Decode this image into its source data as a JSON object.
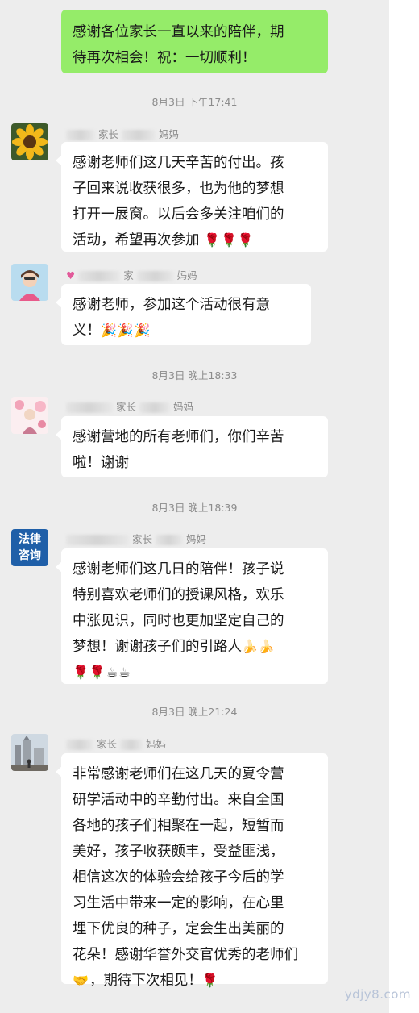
{
  "self_message": {
    "lines": [
      "感谢各位家长一直以来的陪伴，期",
      "待再次相会！祝：一切顺利！"
    ]
  },
  "messages": [
    {
      "time": "8月3日 下午17:41",
      "avatar": "sunflower-avatar",
      "sender_suffix_a": "家长",
      "sender_suffix_b": "妈妈",
      "lines": [
        "感谢老师们这几天辛苦的付出。孩",
        "子回来说收获很多，也为他的梦想",
        "打开一展窗。以后会多关注咱们的",
        "活动，希望再次参加"
      ],
      "emojis": "🌹🌹🌹"
    },
    {
      "time": "",
      "avatar": "girl-avatar",
      "sender_suffix_a": "家",
      "sender_suffix_b": "妈妈",
      "lines": [
        "感谢老师，参加这个活动很有意",
        "义！"
      ],
      "emojis": "🎉🎉🎉"
    },
    {
      "time": "8月3日 晚上18:33",
      "avatar": "flower-girl-avatar",
      "sender_suffix_a": "家长",
      "sender_suffix_b": "妈妈",
      "lines": [
        "感谢营地的所有老师们，你们辛苦",
        "啦！谢谢"
      ]
    },
    {
      "time": "8月3日 晚上18:39",
      "avatar": "legal-consult-avatar",
      "avatar_text": [
        "法律",
        "咨询"
      ],
      "sender_suffix_a": "家长",
      "sender_suffix_b": "妈妈",
      "lines": [
        "感谢老师们这几日的陪伴！孩子说",
        "特别喜欢老师们的授课风格，欢乐",
        "中涨见识，同时也更加坚定自己的",
        "梦想！谢谢孩子们的引路人"
      ],
      "emojis_line4": "🍌🍌",
      "emojis_line5": "🌹🌹☕☕"
    },
    {
      "time": "8月3日 晚上21:24",
      "avatar": "city-avatar",
      "sender_suffix_a": "家长",
      "sender_suffix_b": "妈妈",
      "lines": [
        "非常感谢老师们在这几天的夏令营",
        "研学活动中的辛勤付出。来自全国",
        "各地的孩子们相聚在一起，短暂而",
        "美好，孩子收获颇丰，受益匪浅，",
        "相信这次的体验会给孩子今后的学",
        "习生活中带来一定的影响，在心里",
        "埋下优良的种子，定会生出美丽的",
        "花朵！感谢华誉外交官优秀的老师们",
        "，期待下次相见！"
      ],
      "emojis_start_last": "🤝",
      "emojis_end_last": "🌹"
    }
  ],
  "watermark": "ydjy8.com",
  "colors": {
    "chat_bg": "#ededed",
    "self_bubble": "#95ec69",
    "other_bubble": "#ffffff",
    "timestamp": "#8c8c8c"
  }
}
